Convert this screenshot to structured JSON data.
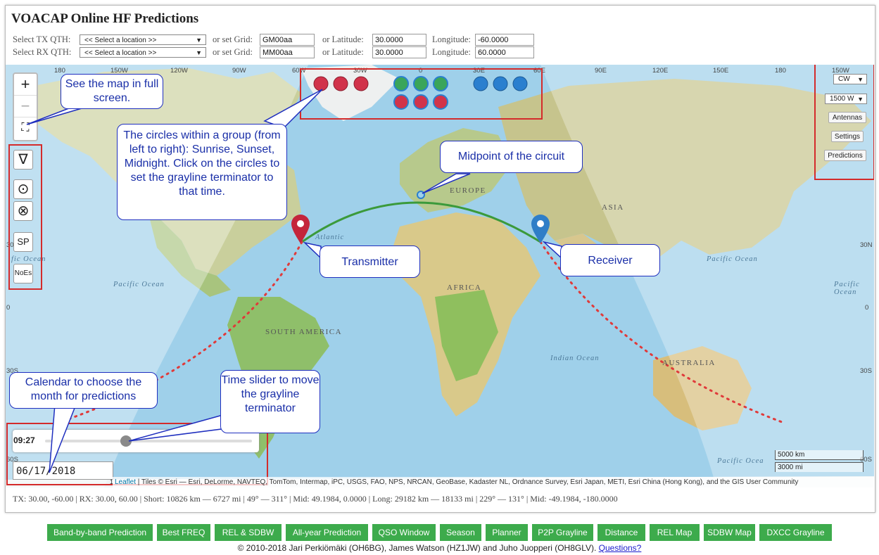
{
  "page": {
    "title": "VOACAP Online HF Predictions"
  },
  "tx_row": {
    "label": "Select TX QTH:",
    "location_select": "<< Select a location >>",
    "grid_label": "or set Grid:",
    "grid": "GM00aa",
    "lat_label": "or  Latitude:",
    "lat": "30.0000",
    "lon_label": "Longitude:",
    "lon": "-60.0000"
  },
  "rx_row": {
    "label": "Select RX QTH:",
    "location_select": "<< Select a location >>",
    "grid_label": "or set Grid:",
    "grid": "MM00aa",
    "lat_label": "or  Latitude:",
    "lat": "30.0000",
    "lon_label": "Longitude:",
    "lon": "60.0000"
  },
  "map": {
    "lon_labels": [
      "180",
      "150W",
      "120W",
      "90W",
      "60W",
      "30W",
      "0",
      "30E",
      "60E",
      "90E",
      "120E",
      "150E",
      "180",
      "150W"
    ],
    "lat_labels_left": [
      "30",
      "0",
      "30S",
      "60S"
    ],
    "lat_labels_right": [
      "30N",
      "0",
      "30S",
      "60S"
    ],
    "oceans": [
      "Pacific Ocean",
      "Pacific Ocean",
      "Pacific Ocean",
      "Indian Ocean",
      "Pacific Ocea",
      "fic Ocean",
      "Atlantic"
    ],
    "continents": [
      "EUROPE",
      "ASIA",
      "AFRICA",
      "SOUTH AMERICA",
      "AUSTRALIA"
    ],
    "zoom_in": "+",
    "zoom_out": "−",
    "fullscreen": "⛶",
    "tools": {
      "grayline": "∇",
      "sun": "⊙",
      "cross": "⊗",
      "sp": "SP",
      "noes": "NoEs"
    },
    "right_panel": {
      "mode": "CW",
      "power": "1500 W",
      "antennas": "Antennas",
      "settings": "Settings",
      "predictions": "Predictions"
    },
    "slider": {
      "time": "09:27",
      "position": 0.39
    },
    "date": "06/17/2018",
    "scale": {
      "km": "5000 km",
      "mi": "3000 mi"
    },
    "attribution": {
      "leaflet": "Leaflet",
      "text": " | Tiles © Esri — Esri, DeLorme, NAVTEQ, TomTom, Intermap, iPC, USGS, FAO, NPS, NRCAN, GeoBase, Kadaster NL, Ordnance Survey, Esri Japan, METI, Esri China (Hong Kong), and the GIS User Community"
    },
    "attrib_prefix": "1"
  },
  "callouts": {
    "fullscreen": "See the map in full screen.",
    "circles": "The circles within a group (from left to right): Sunrise, Sunset, Midnight. Click on the circles to set the grayline terminator to that time.",
    "midpoint": "Midpoint of the circuit",
    "transmitter": "Transmitter",
    "receiver": "Receiver",
    "calendar": "Calendar to choose the month for predictions",
    "slider": "Time slider to move the grayline terminator"
  },
  "status": "TX: 30.00, -60.00  |  RX: 30.00, 60.00  |  Short: 10826 km — 6727 mi  |   49° — 311°  |  Mid: 49.1984, 0.0000  |  Long: 29182 km — 18133 mi  |   229° — 131°  |  Mid: -49.1984, -180.0000",
  "nav_buttons": [
    "Band-by-band Prediction",
    "Best FREQ",
    "REL & SDBW",
    "All-year Prediction",
    "QSO Window",
    "Season",
    "Planner",
    "P2P Grayline",
    "Distance",
    "REL Map",
    "SDBW Map",
    "DXCC Grayline"
  ],
  "footer": {
    "text": "© 2010-2018 Jari Perkiömäki (OH6BG), James Watson (HZ1JW) and Juho Juopperi (OH8GLV). ",
    "link": "Questions?"
  },
  "colors": {
    "red_circle": "#d1334a",
    "green_circle": "#3aa55a",
    "blue_circle": "#2a7fcf",
    "path_short": "#3b9a3b",
    "path_long": "#e03a3a",
    "nav_green": "#3dab4c"
  }
}
